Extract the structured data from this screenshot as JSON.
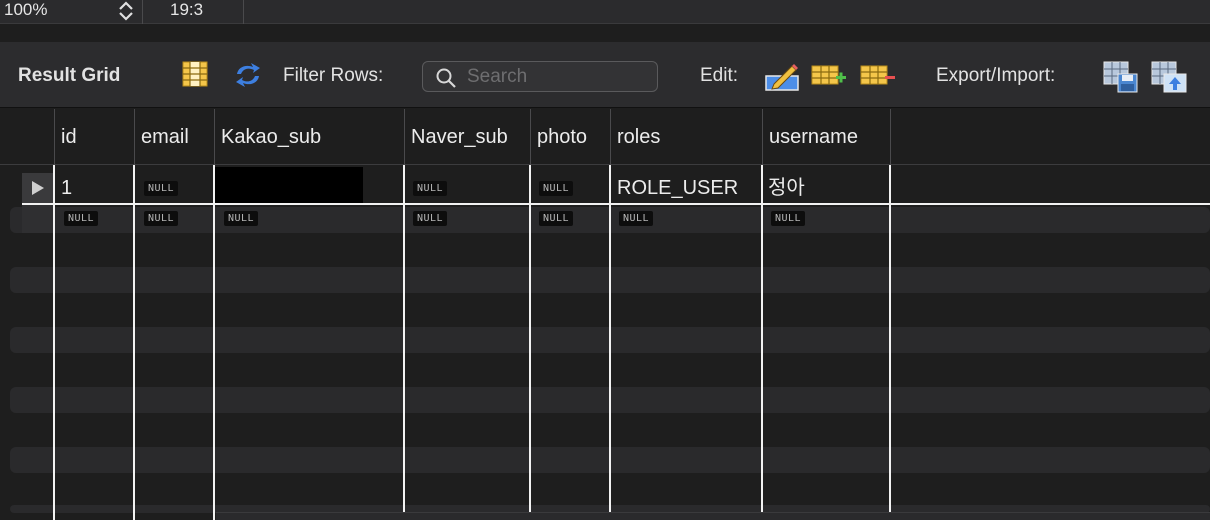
{
  "statusbar": {
    "zoom": "100%",
    "position": "19:3"
  },
  "toolbar": {
    "result_grid_label": "Result Grid",
    "filter_rows_label": "Filter Rows:",
    "search_placeholder": "Search",
    "edit_label": "Edit:",
    "export_import_label": "Export/Import:"
  },
  "icons": {
    "toggle_grid": "grid-columns-icon",
    "refresh": "refresh-icon",
    "search": "search-icon",
    "edit_cell": "edit-pencil-icon",
    "add_row": "add-row-icon",
    "delete_row": "delete-row-icon",
    "export": "export-icon",
    "import": "import-icon"
  },
  "grid": {
    "columns": [
      "id",
      "email",
      "Kakao_sub",
      "Naver_sub",
      "photo",
      "roles",
      "username"
    ],
    "rows": [
      {
        "id": "1",
        "email": "NULL",
        "kakao_sub": "",
        "naver_sub": "NULL",
        "photo": "NULL",
        "roles": "ROLE_USER",
        "username": "정아"
      },
      {
        "id": "NULL",
        "email": "NULL",
        "kakao_sub": "NULL",
        "naver_sub": "NULL",
        "photo": "NULL",
        "roles": "NULL",
        "username": "NULL"
      }
    ]
  },
  "colors": {
    "background": "#1e1e1e",
    "toolbar": "#2c2c2e",
    "grid_line": "#f2f2f2",
    "null_badge": "#0d0d0d"
  }
}
